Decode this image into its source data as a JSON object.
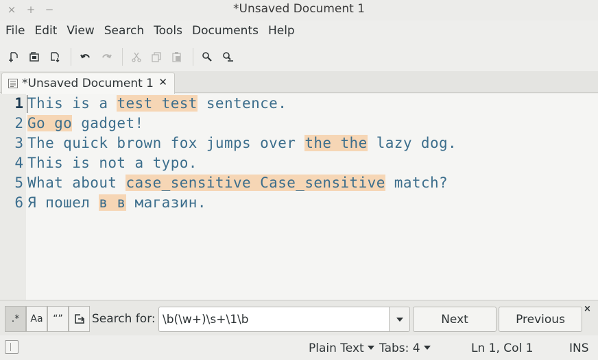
{
  "window": {
    "title": "*Unsaved Document 1",
    "controls": [
      "×",
      "+",
      "−"
    ]
  },
  "menubar": {
    "items": [
      "File",
      "Edit",
      "View",
      "Search",
      "Tools",
      "Documents",
      "Help"
    ]
  },
  "toolbar": {
    "buttons": [
      "new-document-icon",
      "open-icon",
      "save-icon",
      "undo-icon",
      "redo-icon",
      "cut-icon",
      "copy-icon",
      "paste-icon",
      "find-icon",
      "find-replace-icon"
    ]
  },
  "tabs": [
    {
      "label": "*Unsaved Document 1",
      "close": "✕"
    }
  ],
  "editor": {
    "current_line": 1,
    "highlight_color": "#f6d6b5",
    "lines": [
      {
        "num": "1",
        "segments": [
          {
            "t": "This is a ",
            "hl": false
          },
          {
            "t": "test test",
            "hl": true
          },
          {
            "t": " sentence.",
            "hl": false
          }
        ]
      },
      {
        "num": "2",
        "segments": [
          {
            "t": "Go go",
            "hl": true
          },
          {
            "t": " gadget!",
            "hl": false
          }
        ]
      },
      {
        "num": "3",
        "segments": [
          {
            "t": "The quick brown fox jumps over ",
            "hl": false
          },
          {
            "t": "the the",
            "hl": true
          },
          {
            "t": " lazy dog.",
            "hl": false
          }
        ]
      },
      {
        "num": "4",
        "segments": [
          {
            "t": "This is not a typo.",
            "hl": false
          }
        ]
      },
      {
        "num": "5",
        "segments": [
          {
            "t": "What about ",
            "hl": false
          },
          {
            "t": "case_sensitive Case_sensitive",
            "hl": true
          },
          {
            "t": " match?",
            "hl": false
          }
        ]
      },
      {
        "num": "6",
        "segments": [
          {
            "t": "Я пошел ",
            "hl": false
          },
          {
            "t": "в в",
            "hl": true
          },
          {
            "t": " магазин.",
            "hl": false
          }
        ]
      }
    ]
  },
  "search": {
    "options": [
      {
        "label": ".*",
        "name": "regex-toggle",
        "active": true
      },
      {
        "label": "Aa",
        "name": "match-case-toggle",
        "active": false
      },
      {
        "label": "“”",
        "name": "whole-word-toggle",
        "active": false
      },
      {
        "label": "wrap-around-icon",
        "name": "wrap-around-toggle",
        "active": false
      }
    ],
    "label": "Search for:",
    "value": "\\b(\\w+)\\s+\\1\\b",
    "next_label": "Next",
    "previous_label": "Previous",
    "close": "×"
  },
  "statusbar": {
    "language": "Plain Text",
    "tabs": "Tabs: 4",
    "position": "Ln 1, Col 1",
    "mode": "INS"
  }
}
